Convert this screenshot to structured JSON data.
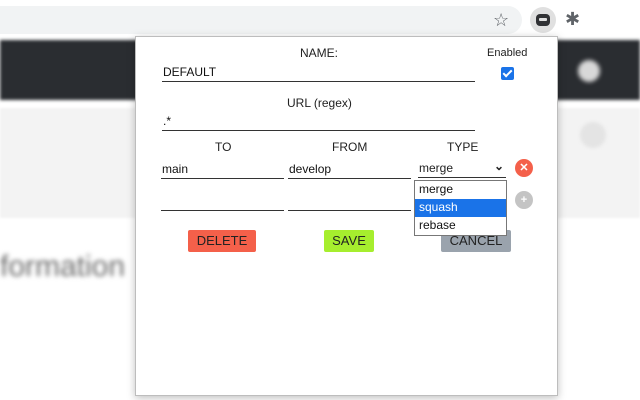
{
  "browser": {
    "icons": {
      "star": "star-icon",
      "extension": "bot-extension-icon",
      "puzzle": "puzzle-icon",
      "menu": "kebab-menu-icon"
    }
  },
  "background": {
    "visible_text": "formation"
  },
  "popup": {
    "name_label": "NAME:",
    "name_value": "DEFAULT",
    "enabled_label": "Enabled",
    "enabled_checked": true,
    "url_label": "URL (regex)",
    "url_value": ".*",
    "columns": {
      "to": "TO",
      "from": "FROM",
      "type": "TYPE"
    },
    "rules": [
      {
        "to": "main",
        "from": "develop",
        "type": "merge"
      },
      {
        "to": "",
        "from": "",
        "type": ""
      }
    ],
    "remove_rule_icon": "close-circle-icon",
    "add_rule_icon": "plus-circle-icon",
    "type_dropdown": {
      "options": [
        "merge",
        "squash",
        "rebase"
      ],
      "highlighted": "squash"
    },
    "buttons": {
      "delete": "DELETE",
      "save": "SAVE",
      "cancel": "CANCEL"
    },
    "colors": {
      "delete": "#f4604a",
      "save": "#a6ee2e",
      "cancel": "#9aa3ad",
      "remove": "#f4604a",
      "add": "#c4c4c4",
      "highlight": "#1a73e8"
    }
  }
}
